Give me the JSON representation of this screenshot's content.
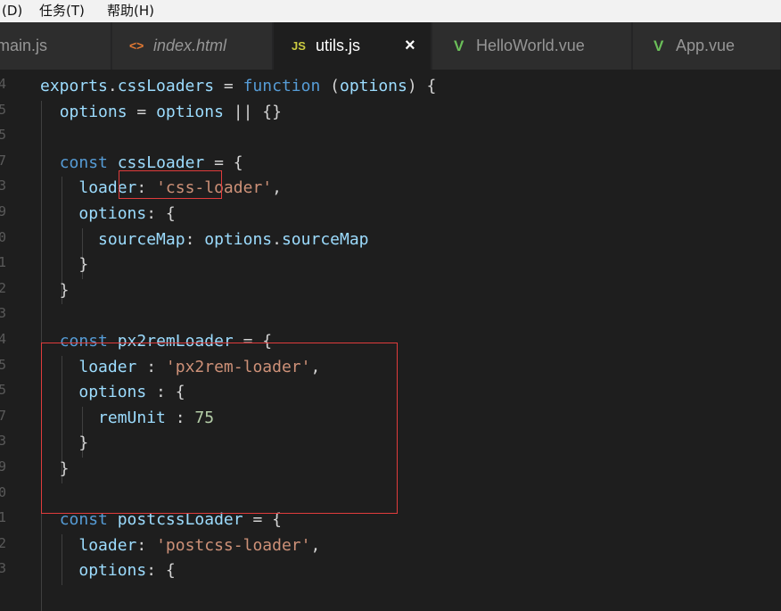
{
  "menubar": {
    "items": [
      "(D)",
      "任务(T)",
      "帮助(H)"
    ]
  },
  "tabs": [
    {
      "icon": "",
      "label": "main.js",
      "active": false,
      "italic": false
    },
    {
      "icon": "<>",
      "label": "index.html",
      "active": false,
      "italic": true
    },
    {
      "icon": "JS",
      "label": "utils.js",
      "active": true,
      "italic": false,
      "close": "×"
    },
    {
      "icon": "V",
      "label": "HelloWorld.vue",
      "active": false,
      "italic": false
    },
    {
      "icon": "V",
      "label": "App.vue",
      "active": false,
      "italic": false
    }
  ],
  "colors": {
    "keyword": "#569cd6",
    "identifier": "#9cdcfe",
    "function": "#dcdcaa",
    "string": "#ce9178",
    "number": "#b5cea8",
    "highlight_box": "#e03c3c",
    "js_icon": "#cbcb41",
    "vue_icon": "#6bbf59",
    "html_icon": "#e37933"
  },
  "editor": {
    "line_numbers": [
      "4",
      "5",
      "5",
      "7",
      "3",
      "9",
      "0",
      "1",
      "2",
      "3",
      "4",
      "5",
      "5",
      "7",
      "3",
      "9",
      "0",
      "1",
      "2",
      "3"
    ],
    "code": [
      [
        [
          "exports",
          "id"
        ],
        [
          ".",
          "pun"
        ],
        [
          "cssLoaders",
          "id"
        ],
        [
          " = ",
          "pun"
        ],
        [
          "function",
          "kw"
        ],
        [
          " (",
          "pun"
        ],
        [
          "options",
          "id"
        ],
        [
          ") {",
          "pun"
        ]
      ],
      [
        [
          "  ",
          "pun"
        ],
        [
          "options",
          "id"
        ],
        [
          " = ",
          "pun"
        ],
        [
          "options",
          "id"
        ],
        [
          " || {}",
          "pun"
        ]
      ],
      [],
      [
        [
          "  ",
          "pun"
        ],
        [
          "const",
          "kw"
        ],
        [
          " ",
          "pun"
        ],
        [
          "cssLoader",
          "id"
        ],
        [
          " = {",
          "pun"
        ]
      ],
      [
        [
          "    ",
          "pun"
        ],
        [
          "loader",
          "id"
        ],
        [
          ": ",
          "pun"
        ],
        [
          "'css-loader'",
          "str"
        ],
        [
          ",",
          "pun"
        ]
      ],
      [
        [
          "    ",
          "pun"
        ],
        [
          "options",
          "id"
        ],
        [
          ": {",
          "pun"
        ]
      ],
      [
        [
          "      ",
          "pun"
        ],
        [
          "sourceMap",
          "id"
        ],
        [
          ": ",
          "pun"
        ],
        [
          "options",
          "id"
        ],
        [
          ".",
          "pun"
        ],
        [
          "sourceMap",
          "id"
        ]
      ],
      [
        [
          "    }",
          "pun"
        ]
      ],
      [
        [
          "  }",
          "pun"
        ]
      ],
      [],
      [
        [
          "  ",
          "pun"
        ],
        [
          "const",
          "kw"
        ],
        [
          " ",
          "pun"
        ],
        [
          "px2remLoader",
          "id"
        ],
        [
          " = {",
          "pun"
        ]
      ],
      [
        [
          "    ",
          "pun"
        ],
        [
          "loader",
          "id"
        ],
        [
          " : ",
          "pun"
        ],
        [
          "'px2rem-loader'",
          "str"
        ],
        [
          ",",
          "pun"
        ]
      ],
      [
        [
          "    ",
          "pun"
        ],
        [
          "options",
          "id"
        ],
        [
          " : {",
          "pun"
        ]
      ],
      [
        [
          "      ",
          "pun"
        ],
        [
          "remUnit",
          "id"
        ],
        [
          " : ",
          "pun"
        ],
        [
          "75",
          "num"
        ]
      ],
      [
        [
          "    }",
          "pun"
        ]
      ],
      [
        [
          "  }",
          "pun"
        ]
      ],
      [],
      [
        [
          "  ",
          "pun"
        ],
        [
          "const",
          "kw"
        ],
        [
          " ",
          "pun"
        ],
        [
          "postcssLoader",
          "id"
        ],
        [
          " = {",
          "pun"
        ]
      ],
      [
        [
          "    ",
          "pun"
        ],
        [
          "loader",
          "id"
        ],
        [
          ": ",
          "pun"
        ],
        [
          "'postcss-loader'",
          "str"
        ],
        [
          ",",
          "pun"
        ]
      ],
      [
        [
          "    ",
          "pun"
        ],
        [
          "options",
          "id"
        ],
        [
          ": {",
          "pun"
        ]
      ]
    ]
  }
}
